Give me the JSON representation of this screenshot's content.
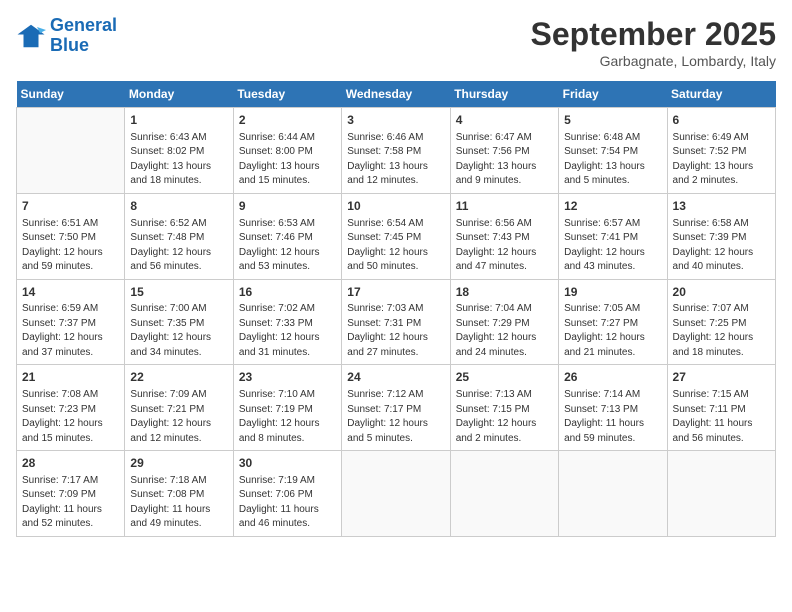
{
  "header": {
    "logo_line1": "General",
    "logo_line2": "Blue",
    "month_title": "September 2025",
    "location": "Garbagnate, Lombardy, Italy"
  },
  "days_of_week": [
    "Sunday",
    "Monday",
    "Tuesday",
    "Wednesday",
    "Thursday",
    "Friday",
    "Saturday"
  ],
  "weeks": [
    [
      {
        "num": "",
        "info": ""
      },
      {
        "num": "1",
        "info": "Sunrise: 6:43 AM\nSunset: 8:02 PM\nDaylight: 13 hours\nand 18 minutes."
      },
      {
        "num": "2",
        "info": "Sunrise: 6:44 AM\nSunset: 8:00 PM\nDaylight: 13 hours\nand 15 minutes."
      },
      {
        "num": "3",
        "info": "Sunrise: 6:46 AM\nSunset: 7:58 PM\nDaylight: 13 hours\nand 12 minutes."
      },
      {
        "num": "4",
        "info": "Sunrise: 6:47 AM\nSunset: 7:56 PM\nDaylight: 13 hours\nand 9 minutes."
      },
      {
        "num": "5",
        "info": "Sunrise: 6:48 AM\nSunset: 7:54 PM\nDaylight: 13 hours\nand 5 minutes."
      },
      {
        "num": "6",
        "info": "Sunrise: 6:49 AM\nSunset: 7:52 PM\nDaylight: 13 hours\nand 2 minutes."
      }
    ],
    [
      {
        "num": "7",
        "info": "Sunrise: 6:51 AM\nSunset: 7:50 PM\nDaylight: 12 hours\nand 59 minutes."
      },
      {
        "num": "8",
        "info": "Sunrise: 6:52 AM\nSunset: 7:48 PM\nDaylight: 12 hours\nand 56 minutes."
      },
      {
        "num": "9",
        "info": "Sunrise: 6:53 AM\nSunset: 7:46 PM\nDaylight: 12 hours\nand 53 minutes."
      },
      {
        "num": "10",
        "info": "Sunrise: 6:54 AM\nSunset: 7:45 PM\nDaylight: 12 hours\nand 50 minutes."
      },
      {
        "num": "11",
        "info": "Sunrise: 6:56 AM\nSunset: 7:43 PM\nDaylight: 12 hours\nand 47 minutes."
      },
      {
        "num": "12",
        "info": "Sunrise: 6:57 AM\nSunset: 7:41 PM\nDaylight: 12 hours\nand 43 minutes."
      },
      {
        "num": "13",
        "info": "Sunrise: 6:58 AM\nSunset: 7:39 PM\nDaylight: 12 hours\nand 40 minutes."
      }
    ],
    [
      {
        "num": "14",
        "info": "Sunrise: 6:59 AM\nSunset: 7:37 PM\nDaylight: 12 hours\nand 37 minutes."
      },
      {
        "num": "15",
        "info": "Sunrise: 7:00 AM\nSunset: 7:35 PM\nDaylight: 12 hours\nand 34 minutes."
      },
      {
        "num": "16",
        "info": "Sunrise: 7:02 AM\nSunset: 7:33 PM\nDaylight: 12 hours\nand 31 minutes."
      },
      {
        "num": "17",
        "info": "Sunrise: 7:03 AM\nSunset: 7:31 PM\nDaylight: 12 hours\nand 27 minutes."
      },
      {
        "num": "18",
        "info": "Sunrise: 7:04 AM\nSunset: 7:29 PM\nDaylight: 12 hours\nand 24 minutes."
      },
      {
        "num": "19",
        "info": "Sunrise: 7:05 AM\nSunset: 7:27 PM\nDaylight: 12 hours\nand 21 minutes."
      },
      {
        "num": "20",
        "info": "Sunrise: 7:07 AM\nSunset: 7:25 PM\nDaylight: 12 hours\nand 18 minutes."
      }
    ],
    [
      {
        "num": "21",
        "info": "Sunrise: 7:08 AM\nSunset: 7:23 PM\nDaylight: 12 hours\nand 15 minutes."
      },
      {
        "num": "22",
        "info": "Sunrise: 7:09 AM\nSunset: 7:21 PM\nDaylight: 12 hours\nand 12 minutes."
      },
      {
        "num": "23",
        "info": "Sunrise: 7:10 AM\nSunset: 7:19 PM\nDaylight: 12 hours\nand 8 minutes."
      },
      {
        "num": "24",
        "info": "Sunrise: 7:12 AM\nSunset: 7:17 PM\nDaylight: 12 hours\nand 5 minutes."
      },
      {
        "num": "25",
        "info": "Sunrise: 7:13 AM\nSunset: 7:15 PM\nDaylight: 12 hours\nand 2 minutes."
      },
      {
        "num": "26",
        "info": "Sunrise: 7:14 AM\nSunset: 7:13 PM\nDaylight: 11 hours\nand 59 minutes."
      },
      {
        "num": "27",
        "info": "Sunrise: 7:15 AM\nSunset: 7:11 PM\nDaylight: 11 hours\nand 56 minutes."
      }
    ],
    [
      {
        "num": "28",
        "info": "Sunrise: 7:17 AM\nSunset: 7:09 PM\nDaylight: 11 hours\nand 52 minutes."
      },
      {
        "num": "29",
        "info": "Sunrise: 7:18 AM\nSunset: 7:08 PM\nDaylight: 11 hours\nand 49 minutes."
      },
      {
        "num": "30",
        "info": "Sunrise: 7:19 AM\nSunset: 7:06 PM\nDaylight: 11 hours\nand 46 minutes."
      },
      {
        "num": "",
        "info": ""
      },
      {
        "num": "",
        "info": ""
      },
      {
        "num": "",
        "info": ""
      },
      {
        "num": "",
        "info": ""
      }
    ]
  ]
}
